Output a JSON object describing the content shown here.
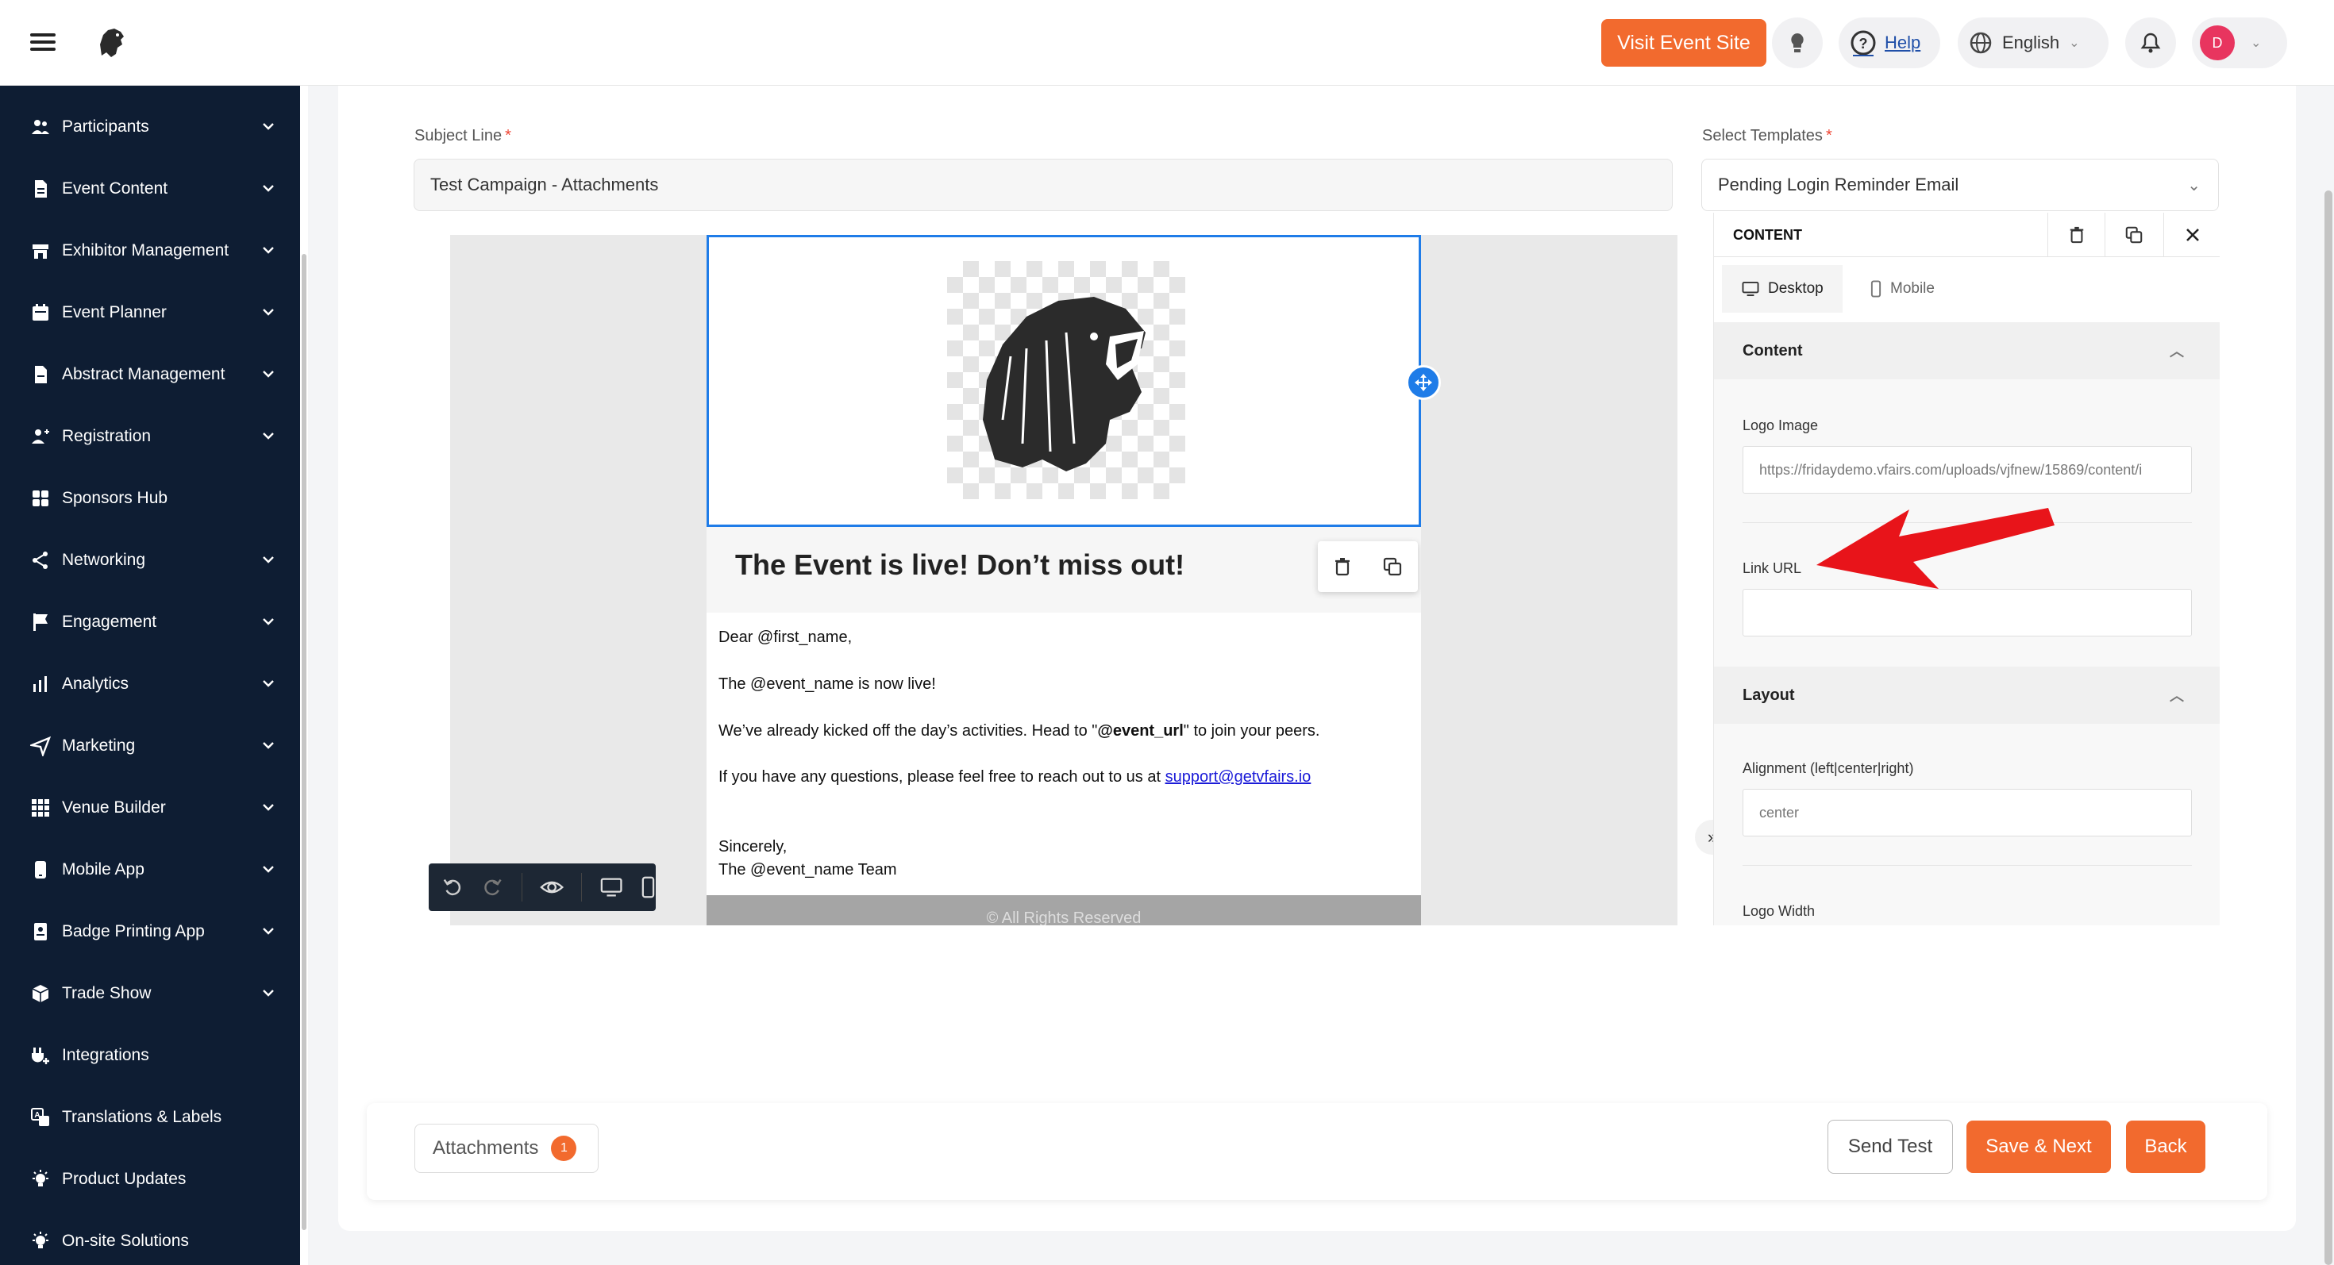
{
  "header": {
    "visit_btn": "Visit Event Site",
    "help": "Help",
    "language": "English",
    "avatar_initial": "D"
  },
  "sidebar": {
    "items": [
      {
        "label": "Participants",
        "icon": "users-icon",
        "has_chevron": true
      },
      {
        "label": "Event Content",
        "icon": "document-icon",
        "has_chevron": true
      },
      {
        "label": "Exhibitor Management",
        "icon": "store-icon",
        "has_chevron": true
      },
      {
        "label": "Event Planner",
        "icon": "calendar-icon",
        "has_chevron": true
      },
      {
        "label": "Abstract Management",
        "icon": "file-icon",
        "has_chevron": true
      },
      {
        "label": "Registration",
        "icon": "user-plus-icon",
        "has_chevron": true
      },
      {
        "label": "Sponsors Hub",
        "icon": "grid-icon",
        "has_chevron": false
      },
      {
        "label": "Networking",
        "icon": "share-icon",
        "has_chevron": true
      },
      {
        "label": "Engagement",
        "icon": "flag-icon",
        "has_chevron": true
      },
      {
        "label": "Analytics",
        "icon": "bar-chart-icon",
        "has_chevron": true
      },
      {
        "label": "Marketing",
        "icon": "send-icon",
        "has_chevron": true
      },
      {
        "label": "Venue Builder",
        "icon": "dots-grid-icon",
        "has_chevron": true
      },
      {
        "label": "Mobile App",
        "icon": "mobile-icon",
        "has_chevron": true
      },
      {
        "label": "Badge Printing App",
        "icon": "badge-icon",
        "has_chevron": true
      },
      {
        "label": "Trade Show",
        "icon": "box-icon",
        "has_chevron": true
      },
      {
        "label": "Integrations",
        "icon": "plug-icon",
        "has_chevron": false
      },
      {
        "label": "Translations & Labels",
        "icon": "translate-icon",
        "has_chevron": false
      },
      {
        "label": "Product Updates",
        "icon": "bulb-icon",
        "has_chevron": false
      },
      {
        "label": "On-site Solutions",
        "icon": "bulb-icon",
        "has_chevron": false
      }
    ]
  },
  "form": {
    "subject_label": "Subject Line",
    "subject_value": "Test Campaign - Attachments",
    "templates_label": "Select Templates",
    "templates_value": "Pending Login Reminder Email",
    "required_mark": "*"
  },
  "email": {
    "title": "The Event is live! Don’t miss out!",
    "greeting": "Dear @first_name,",
    "line1": "The @event_name is now live!",
    "line2_pre": "We’ve already kicked off the day’s activities. Head to \"",
    "line2_bold": "@event_url",
    "line2_post": "\" to join your peers.",
    "line3_pre": "If you have any questions, please feel free to reach out to us at ",
    "line3_link": "support@getvfairs.io",
    "signoff": "Sincerely,",
    "team": "The @event_name Team",
    "footer": "© All Rights Reserved"
  },
  "panel": {
    "title": "CONTENT",
    "tabs": [
      "Desktop",
      "Mobile"
    ],
    "section_content": "Content",
    "logo_image_label": "Logo Image",
    "logo_image_value": "https://fridaydemo.vfairs.com/uploads/vjfnew/15869/content/i",
    "link_url_label": "Link URL",
    "link_url_value": "",
    "section_layout": "Layout",
    "alignment_label": "Alignment (left|center|right)",
    "alignment_placeholder": "center",
    "logo_width_label": "Logo Width"
  },
  "footer": {
    "attachments": "Attachments",
    "attachments_count": "1",
    "send_test": "Send Test",
    "save_next": "Save & Next",
    "back": "Back"
  },
  "colors": {
    "accent": "#f26a2e",
    "sidebar_bg": "#0e1d33",
    "selection_blue": "#1f7ce8",
    "annotation_arrow": "#e8141a"
  }
}
